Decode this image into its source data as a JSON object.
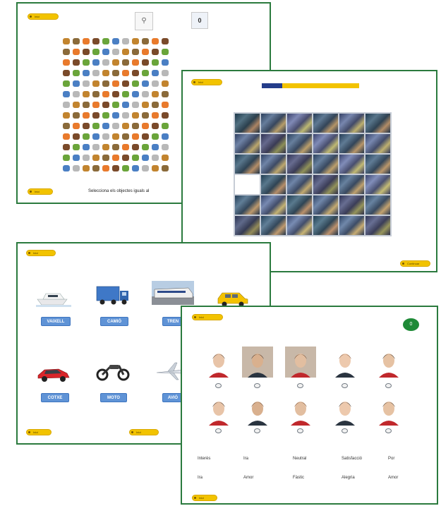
{
  "colors": {
    "panel_border": "#2b7a3e",
    "yellow_button": "#f2c300",
    "label_blue": "#5f93d6",
    "progress_blue": "#243d8a",
    "progress_yellow": "#f2c300",
    "badge_green": "#1e8a37"
  },
  "panel1": {
    "top_button": "Inici",
    "bottom_button": "Inici",
    "selected_symbol": "0",
    "score": "0",
    "instruction": "Selecciona els objectes iguals al"
  },
  "panel2": {
    "top_button": "Inici",
    "bottom_button": "Continuar"
  },
  "panel3": {
    "top_button": "Inici",
    "bottom_left_button": "Inici",
    "bottom_center_button": "Inici",
    "vehicles": [
      {
        "label": "VAIXELL",
        "icon": "boat-icon"
      },
      {
        "label": "CAMIÓ",
        "icon": "truck-icon"
      },
      {
        "label": "TREN",
        "icon": "train-icon"
      },
      {
        "label": "",
        "icon": "taxi-icon"
      },
      {
        "label": "COTXE",
        "icon": "car-icon"
      },
      {
        "label": "MOTO",
        "icon": "motorcycle-icon"
      },
      {
        "label": "AVIÓ",
        "icon": "plane-icon"
      }
    ]
  },
  "panel4": {
    "top_button": "Inici",
    "bottom_button": "Inici",
    "badge": "0",
    "emotions_row1": [
      "Interès",
      "Ira",
      "Neutral",
      "Satisfacció",
      "Por"
    ],
    "emotions_row2": [
      "Ira",
      "Amor",
      "Fàstic",
      "Alegria",
      "Amor"
    ]
  }
}
